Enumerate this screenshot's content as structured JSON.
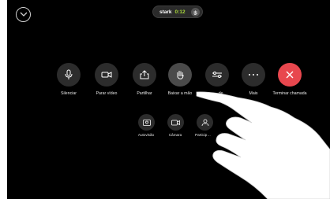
{
  "top": {
    "participant_name": "stark",
    "timer": "0:12"
  },
  "controls": [
    {
      "label": "Silenciar",
      "icon": "microphone-icon"
    },
    {
      "label": "Parar vídeo",
      "icon": "video-camera-icon"
    },
    {
      "label": "Partilhar",
      "icon": "share-icon"
    },
    {
      "label": "Baixar a mão",
      "icon": "raise-hand-icon"
    },
    {
      "label": "…de",
      "icon": "sliders-icon"
    },
    {
      "label": "Mais",
      "icon": "more-icon"
    },
    {
      "label": "Terminar chamada",
      "icon": "end-call-icon"
    }
  ],
  "secondary": [
    {
      "label": "Autovisão",
      "icon": "selfview-icon"
    },
    {
      "label": "Câmara",
      "icon": "camera-control-icon"
    },
    {
      "label": "Particip…",
      "icon": "participants-icon"
    }
  ],
  "colors": {
    "background": "#000000",
    "button": "#2c2c2c",
    "active_button": "#4a4a4a",
    "end_call": "#e8474e",
    "timer": "#a8d63a"
  }
}
